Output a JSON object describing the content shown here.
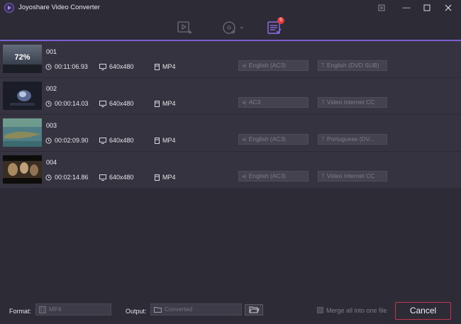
{
  "window": {
    "title": "Joyoshare Video Converter",
    "controls": {
      "menu_icon": "menu-icon",
      "minimize": "—",
      "maximize": "☐",
      "close": "✕"
    }
  },
  "toolbar": {
    "items": [
      {
        "name": "add-video-icon",
        "active": false
      },
      {
        "name": "add-dvd-icon",
        "active": false
      },
      {
        "name": "converting-list-icon",
        "active": true
      }
    ],
    "badge_count": "5",
    "accent": "#7b5fd3"
  },
  "files": [
    {
      "name": "001",
      "duration": "00:11:06.93",
      "resolution": "640x480",
      "format": "MP4",
      "audio": "English (AC3)",
      "subtitle": "English (DVD SUB)",
      "progress_label": "72%",
      "progress": 0.72
    },
    {
      "name": "002",
      "duration": "00:00:14.03",
      "resolution": "640x480",
      "format": "MP4",
      "audio": "AC3",
      "subtitle": "Video Internet CC"
    },
    {
      "name": "003",
      "duration": "00:02:09.90",
      "resolution": "640x480",
      "format": "MP4",
      "audio": "English (AC3)",
      "subtitle": "Portuguese (DV..."
    },
    {
      "name": "004",
      "duration": "00:02:14.86",
      "resolution": "640x480",
      "format": "MP4",
      "audio": "English (AC3)",
      "subtitle": "Video Internet CC"
    }
  ],
  "footer": {
    "format_label": "Format:",
    "format_value": "MP4",
    "output_label": "Output:",
    "output_value": "Converted",
    "merge_label": "Merge all into one file",
    "merge_checked": false,
    "cancel_label": "Cancel",
    "cancel_color": "#c2354c"
  }
}
